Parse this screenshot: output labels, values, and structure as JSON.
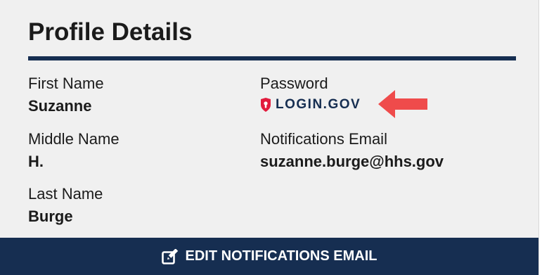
{
  "profile": {
    "title": "Profile Details",
    "first_name": {
      "label": "First Name",
      "value": "Suzanne"
    },
    "middle_name": {
      "label": "Middle Name",
      "value": "H."
    },
    "last_name": {
      "label": "Last Name",
      "value": "Burge"
    },
    "password": {
      "label": "Password",
      "provider": "LOGIN.GOV",
      "provider_icon": "shield-lock-icon"
    },
    "notifications_email": {
      "label": "Notifications Email",
      "value": "suzanne.burge@hhs.gov"
    }
  },
  "annotation": {
    "icon": "red-arrow-left-icon",
    "color": "#ef4b4b"
  },
  "footer": {
    "edit_label": "EDIT NOTIFICATIONS EMAIL",
    "edit_icon": "edit-icon"
  },
  "colors": {
    "navy": "#162e51",
    "background": "#f0f0f0",
    "logo_red": "#e21c3d"
  }
}
